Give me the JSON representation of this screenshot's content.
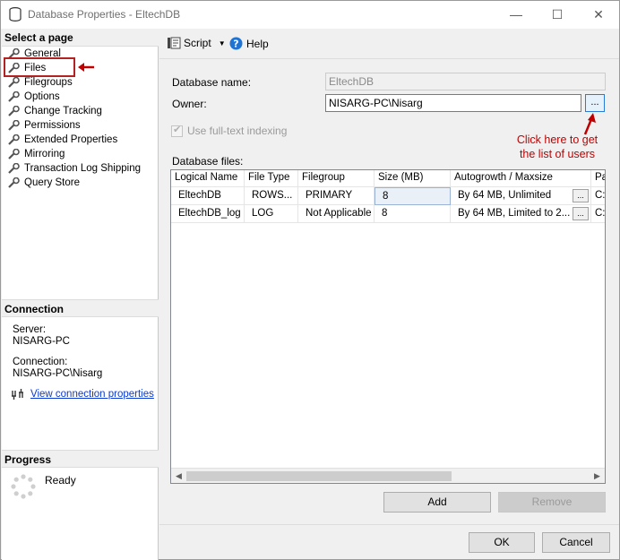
{
  "window": {
    "title": "Database Properties - EltechDB"
  },
  "left": {
    "select_page_header": "Select a page",
    "pages": [
      "General",
      "Files",
      "Filegroups",
      "Options",
      "Change Tracking",
      "Permissions",
      "Extended Properties",
      "Mirroring",
      "Transaction Log Shipping",
      "Query Store"
    ],
    "selected_page": "Files",
    "connection_header": "Connection",
    "server_label": "Server:",
    "server_value": "NISARG-PC",
    "connection_label": "Connection:",
    "connection_value": "NISARG-PC\\Nisarg",
    "view_connection_link": "View connection properties",
    "progress_header": "Progress",
    "progress_status": "Ready"
  },
  "toolbar": {
    "script_label": "Script",
    "help_label": "Help"
  },
  "form": {
    "db_name_label": "Database name:",
    "db_name_value": "EltechDB",
    "owner_label": "Owner:",
    "owner_value": "NISARG-PC\\Nisarg",
    "browse_label": "...",
    "fulltext_label": "Use full-text indexing",
    "fulltext_checked": true,
    "db_files_label": "Database files:"
  },
  "annotation": {
    "line1": "Click here to get",
    "line2": "the list of users",
    "color": "#c00000"
  },
  "files_table": {
    "columns": [
      "Logical Name",
      "File Type",
      "Filegroup",
      "Size (MB)",
      "Autogrowth / Maxsize",
      "Pa"
    ],
    "rows": [
      [
        "EltechDB",
        "ROWS...",
        "PRIMARY",
        "8",
        "By 64 MB, Unlimited",
        "C:"
      ],
      [
        "EltechDB_log",
        "LOG",
        "Not Applicable",
        "8",
        "By 64 MB, Limited to 2...",
        "C:"
      ]
    ],
    "cell_button": "..."
  },
  "buttons": {
    "add": "Add",
    "remove": "Remove",
    "ok": "OK",
    "cancel": "Cancel"
  },
  "colors": {
    "highlight_box": "#b22222",
    "link": "#0b3ad1",
    "annotation": "#c00000"
  }
}
